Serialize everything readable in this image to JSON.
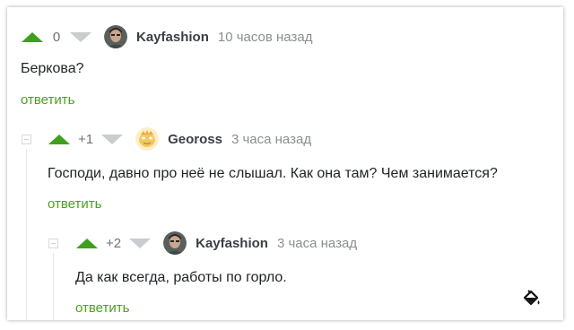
{
  "comments": [
    {
      "rating": "0",
      "author": "Kayfashion",
      "time": "10 часов назад",
      "text": "Беркова?",
      "reply_label": "ответить"
    },
    {
      "rating": "+1",
      "author": "Geoross",
      "time": "3 часа назад",
      "text": "Господи, давно про неё не слышал. Как она там? Чем занимается?",
      "reply_label": "ответить"
    },
    {
      "rating": "+2",
      "author": "Kayfashion",
      "time": "3 часа назад",
      "text": "Да как всегда, работы по горло.",
      "reply_label": "ответить"
    }
  ],
  "colors": {
    "upvote": "#3ea01c",
    "downvote": "#c9ccd0",
    "reply_link": "#4aa020",
    "author": "#3a3f45",
    "meta": "#8a8e93"
  },
  "icons": {
    "upvote": "triangle-up-icon",
    "downvote": "triangle-down-icon",
    "collapse": "collapse-minus-icon",
    "paint": "paint-bucket-icon"
  }
}
